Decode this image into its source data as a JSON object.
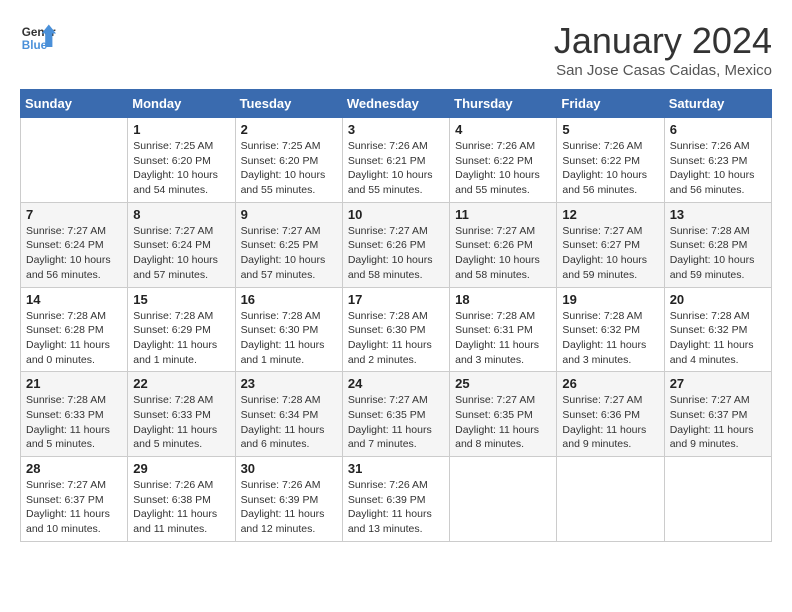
{
  "logo": {
    "line1": "General",
    "line2": "Blue"
  },
  "title": "January 2024",
  "location": "San Jose Casas Caidas, Mexico",
  "days_of_week": [
    "Sunday",
    "Monday",
    "Tuesday",
    "Wednesday",
    "Thursday",
    "Friday",
    "Saturday"
  ],
  "weeks": [
    [
      {
        "day": "",
        "info": ""
      },
      {
        "day": "1",
        "info": "Sunrise: 7:25 AM\nSunset: 6:20 PM\nDaylight: 10 hours\nand 54 minutes."
      },
      {
        "day": "2",
        "info": "Sunrise: 7:25 AM\nSunset: 6:20 PM\nDaylight: 10 hours\nand 55 minutes."
      },
      {
        "day": "3",
        "info": "Sunrise: 7:26 AM\nSunset: 6:21 PM\nDaylight: 10 hours\nand 55 minutes."
      },
      {
        "day": "4",
        "info": "Sunrise: 7:26 AM\nSunset: 6:22 PM\nDaylight: 10 hours\nand 55 minutes."
      },
      {
        "day": "5",
        "info": "Sunrise: 7:26 AM\nSunset: 6:22 PM\nDaylight: 10 hours\nand 56 minutes."
      },
      {
        "day": "6",
        "info": "Sunrise: 7:26 AM\nSunset: 6:23 PM\nDaylight: 10 hours\nand 56 minutes."
      }
    ],
    [
      {
        "day": "7",
        "info": "Sunrise: 7:27 AM\nSunset: 6:24 PM\nDaylight: 10 hours\nand 56 minutes."
      },
      {
        "day": "8",
        "info": "Sunrise: 7:27 AM\nSunset: 6:24 PM\nDaylight: 10 hours\nand 57 minutes."
      },
      {
        "day": "9",
        "info": "Sunrise: 7:27 AM\nSunset: 6:25 PM\nDaylight: 10 hours\nand 57 minutes."
      },
      {
        "day": "10",
        "info": "Sunrise: 7:27 AM\nSunset: 6:26 PM\nDaylight: 10 hours\nand 58 minutes."
      },
      {
        "day": "11",
        "info": "Sunrise: 7:27 AM\nSunset: 6:26 PM\nDaylight: 10 hours\nand 58 minutes."
      },
      {
        "day": "12",
        "info": "Sunrise: 7:27 AM\nSunset: 6:27 PM\nDaylight: 10 hours\nand 59 minutes."
      },
      {
        "day": "13",
        "info": "Sunrise: 7:28 AM\nSunset: 6:28 PM\nDaylight: 10 hours\nand 59 minutes."
      }
    ],
    [
      {
        "day": "14",
        "info": "Sunrise: 7:28 AM\nSunset: 6:28 PM\nDaylight: 11 hours\nand 0 minutes."
      },
      {
        "day": "15",
        "info": "Sunrise: 7:28 AM\nSunset: 6:29 PM\nDaylight: 11 hours\nand 1 minute."
      },
      {
        "day": "16",
        "info": "Sunrise: 7:28 AM\nSunset: 6:30 PM\nDaylight: 11 hours\nand 1 minute."
      },
      {
        "day": "17",
        "info": "Sunrise: 7:28 AM\nSunset: 6:30 PM\nDaylight: 11 hours\nand 2 minutes."
      },
      {
        "day": "18",
        "info": "Sunrise: 7:28 AM\nSunset: 6:31 PM\nDaylight: 11 hours\nand 3 minutes."
      },
      {
        "day": "19",
        "info": "Sunrise: 7:28 AM\nSunset: 6:32 PM\nDaylight: 11 hours\nand 3 minutes."
      },
      {
        "day": "20",
        "info": "Sunrise: 7:28 AM\nSunset: 6:32 PM\nDaylight: 11 hours\nand 4 minutes."
      }
    ],
    [
      {
        "day": "21",
        "info": "Sunrise: 7:28 AM\nSunset: 6:33 PM\nDaylight: 11 hours\nand 5 minutes."
      },
      {
        "day": "22",
        "info": "Sunrise: 7:28 AM\nSunset: 6:33 PM\nDaylight: 11 hours\nand 5 minutes."
      },
      {
        "day": "23",
        "info": "Sunrise: 7:28 AM\nSunset: 6:34 PM\nDaylight: 11 hours\nand 6 minutes."
      },
      {
        "day": "24",
        "info": "Sunrise: 7:27 AM\nSunset: 6:35 PM\nDaylight: 11 hours\nand 7 minutes."
      },
      {
        "day": "25",
        "info": "Sunrise: 7:27 AM\nSunset: 6:35 PM\nDaylight: 11 hours\nand 8 minutes."
      },
      {
        "day": "26",
        "info": "Sunrise: 7:27 AM\nSunset: 6:36 PM\nDaylight: 11 hours\nand 9 minutes."
      },
      {
        "day": "27",
        "info": "Sunrise: 7:27 AM\nSunset: 6:37 PM\nDaylight: 11 hours\nand 9 minutes."
      }
    ],
    [
      {
        "day": "28",
        "info": "Sunrise: 7:27 AM\nSunset: 6:37 PM\nDaylight: 11 hours\nand 10 minutes."
      },
      {
        "day": "29",
        "info": "Sunrise: 7:26 AM\nSunset: 6:38 PM\nDaylight: 11 hours\nand 11 minutes."
      },
      {
        "day": "30",
        "info": "Sunrise: 7:26 AM\nSunset: 6:39 PM\nDaylight: 11 hours\nand 12 minutes."
      },
      {
        "day": "31",
        "info": "Sunrise: 7:26 AM\nSunset: 6:39 PM\nDaylight: 11 hours\nand 13 minutes."
      },
      {
        "day": "",
        "info": ""
      },
      {
        "day": "",
        "info": ""
      },
      {
        "day": "",
        "info": ""
      }
    ]
  ]
}
